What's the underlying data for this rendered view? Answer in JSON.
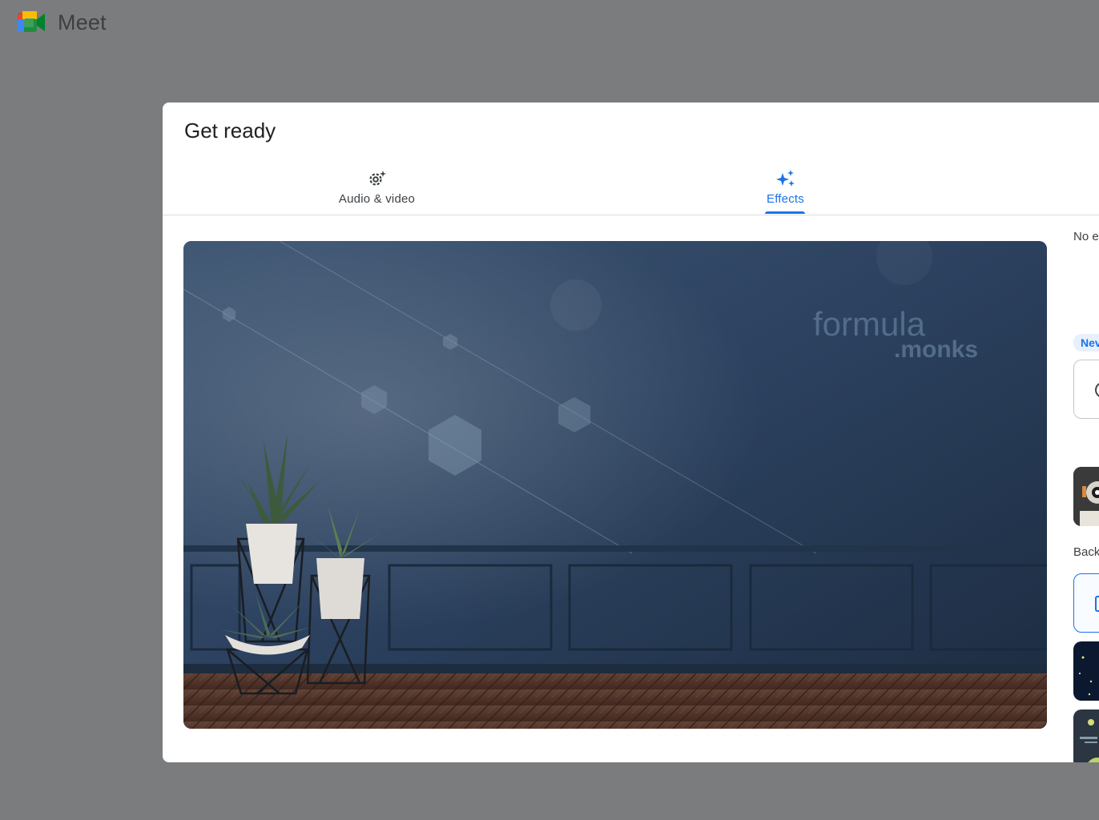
{
  "app": {
    "name": "Meet"
  },
  "dialog": {
    "title": "Get ready",
    "tabs": [
      {
        "label": "Audio & video",
        "icon": "settings-sparkle-icon",
        "active": false
      },
      {
        "label": "Effects",
        "icon": "sparkle-icon",
        "active": true
      }
    ]
  },
  "preview": {
    "background_text_line1": "formula",
    "background_text_line2": ".monks"
  },
  "effects_panel": {
    "no_effect_label": "No e",
    "new_badge": "Nev",
    "backgrounds_label": "Back"
  },
  "colors": {
    "accent": "#1a73e8",
    "page_background": "#7b7c7e",
    "dialog_background": "#ffffff"
  }
}
